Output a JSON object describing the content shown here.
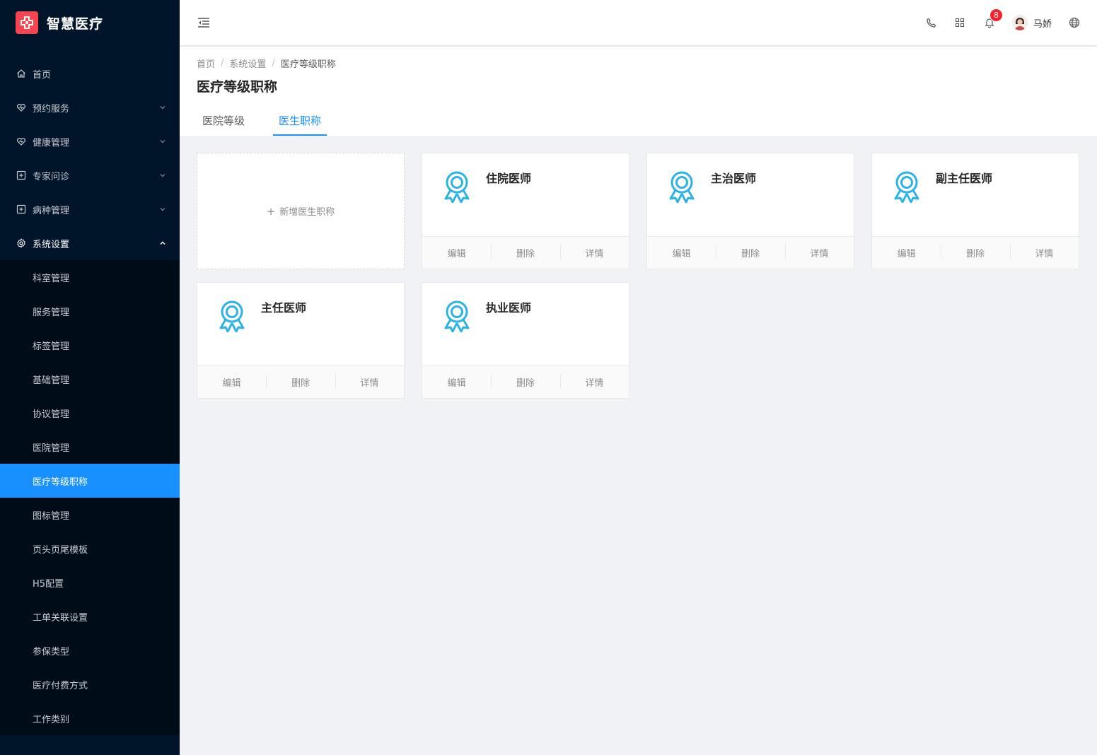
{
  "app": {
    "title": "智慧医疗"
  },
  "sidebar": {
    "menus": [
      {
        "label": "首页",
        "icon": "home-icon"
      },
      {
        "label": "预约服务",
        "icon": "heart-pulse-icon"
      },
      {
        "label": "健康管理",
        "icon": "heart-icon"
      },
      {
        "label": "专家问诊",
        "icon": "medical-plus-icon"
      },
      {
        "label": "病种管理",
        "icon": "medical-plus-icon"
      },
      {
        "label": "系统设置",
        "icon": "gear-icon"
      }
    ],
    "submenu": [
      "科室管理",
      "服务管理",
      "标签管理",
      "基础管理",
      "协议管理",
      "医院管理",
      "医疗等级职称",
      "图标管理",
      "页头页尾模板",
      "H5配置",
      "工单关联设置",
      "参保类型",
      "医疗付费方式",
      "工作类别"
    ]
  },
  "header": {
    "notification_count": "8",
    "user_name": "马娇"
  },
  "breadcrumb": [
    "首页",
    "系统设置",
    "医疗等级职称"
  ],
  "page": {
    "title": "医疗等级职称",
    "tabs": [
      "医院等级",
      "医生职称"
    ]
  },
  "cards": {
    "add_label": "新增医生职称",
    "items": [
      {
        "title": "住院医师"
      },
      {
        "title": "主治医师"
      },
      {
        "title": "副主任医师"
      },
      {
        "title": "主任医师"
      },
      {
        "title": "执业医师"
      }
    ],
    "actions": [
      "编辑",
      "删除",
      "详情"
    ]
  },
  "colors": {
    "sidebar_bg": "#001529",
    "accent": "#1890ff",
    "logo": "#f5454f",
    "award_icon": "#2bb3e6"
  }
}
